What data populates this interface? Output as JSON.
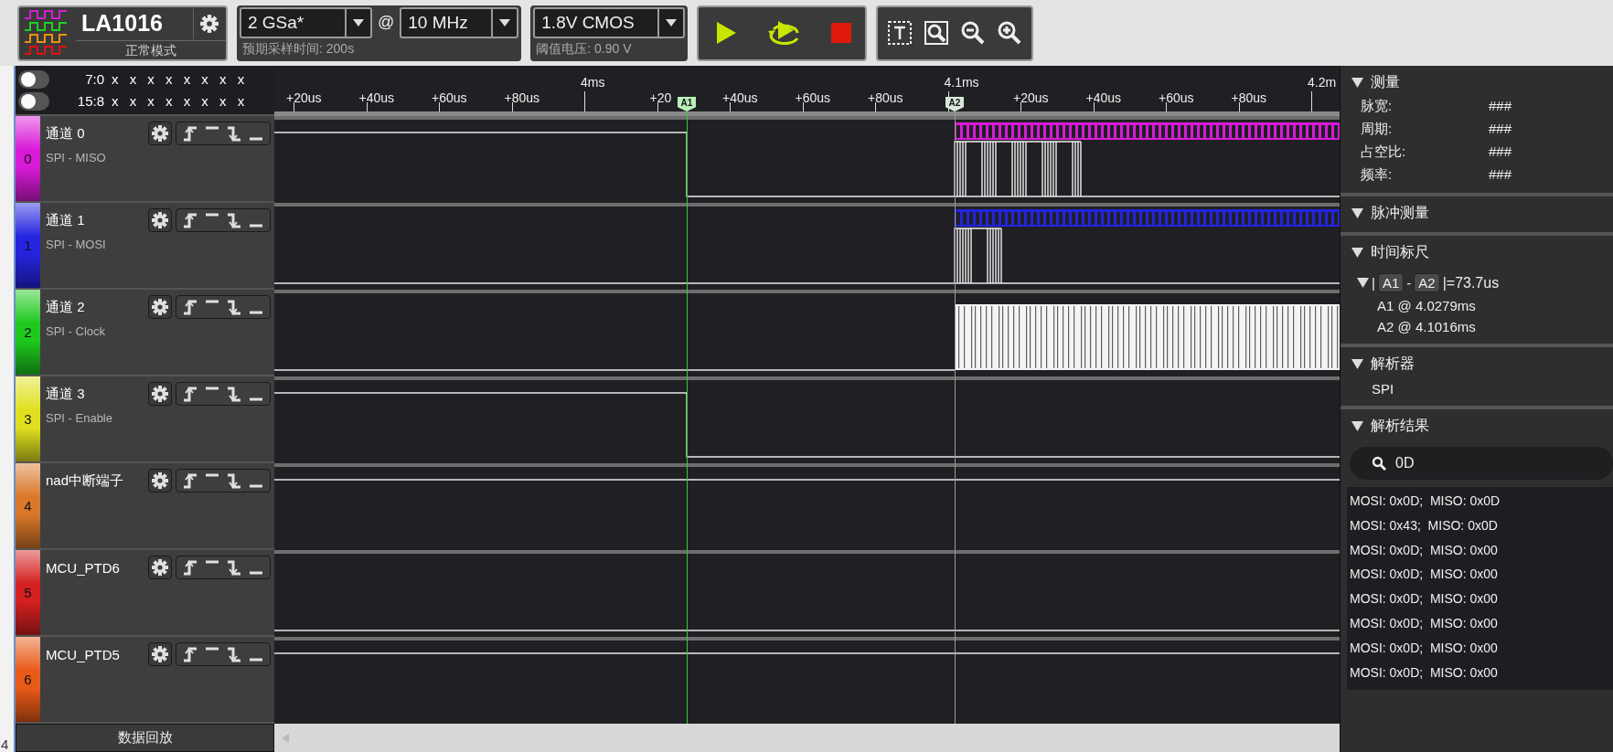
{
  "toolbar": {
    "device": {
      "name": "LA1016",
      "mode": "正常模式"
    },
    "sample_rate": "2 GSa*",
    "at": "@",
    "frequency": "10 MHz",
    "sample_time": "预期采样时间: 200s",
    "threshold": {
      "value": "1.8V CMOS",
      "caption": "阈值电压: 0.90 V"
    }
  },
  "bit_rows": [
    {
      "label": "7:0",
      "bits": "x x x x x x x x",
      "on": false
    },
    {
      "label": "15:8",
      "bits": "x x x x x x x x",
      "on": false
    }
  ],
  "timeline": {
    "ticks": [
      {
        "label": "+20us",
        "major": false
      },
      {
        "label": "+40us",
        "major": false
      },
      {
        "label": "+60us",
        "major": false
      },
      {
        "label": "+80us",
        "major": false
      },
      {
        "label": "4ms",
        "major": true
      },
      {
        "label": "+20",
        "major": false
      },
      {
        "label": "+40us",
        "major": false
      },
      {
        "label": "+60us",
        "major": false
      },
      {
        "label": "+80us",
        "major": false
      },
      {
        "label": "4.1ms",
        "major": true
      },
      {
        "label": "+20us",
        "major": false
      },
      {
        "label": "+40us",
        "major": false
      },
      {
        "label": "+60us",
        "major": false
      },
      {
        "label": "+80us",
        "major": false
      },
      {
        "label": "4.2m",
        "major": true
      }
    ],
    "cursors": [
      {
        "label": "A1",
        "kind": "active"
      },
      {
        "label": "A2",
        "kind": "passive"
      }
    ]
  },
  "channels": [
    {
      "number": "0",
      "name": "通道 0",
      "protocol": "SPI - MISO",
      "color": "#d81ad8",
      "kind": "fall_burst"
    },
    {
      "number": "1",
      "name": "通道 1",
      "protocol": "SPI - MOSI",
      "color": "#2424e0",
      "kind": "burst"
    },
    {
      "number": "2",
      "name": "通道 2",
      "protocol": "SPI - Clock",
      "color": "#1ec81e",
      "kind": "clock"
    },
    {
      "number": "3",
      "name": "通道 3",
      "protocol": "SPI - Enable",
      "color": "#e0e020",
      "kind": "fall"
    },
    {
      "number": "4",
      "name": "nad中断端子",
      "color": "#d9782a",
      "kind": "high"
    },
    {
      "number": "5",
      "name": "MCU_PTD6",
      "color": "#d42020",
      "kind": "low"
    },
    {
      "number": "6",
      "name": "MCU_PTD5",
      "color": "#e85a18",
      "kind": "high"
    }
  ],
  "replay_button": "数据回放",
  "edge_text": "4",
  "panel": {
    "measure": {
      "title": "测量",
      "expanded": true,
      "rows": [
        {
          "label": "脉宽:",
          "value": "###"
        },
        {
          "label": "周期:",
          "value": "###"
        },
        {
          "label": "占空比:",
          "value": "###"
        },
        {
          "label": "频率:",
          "value": "###"
        }
      ]
    },
    "pulse": {
      "title": "脉冲测量",
      "expanded": true
    },
    "ruler": {
      "title": "时间标尺",
      "expanded": true,
      "pair_expanded": true,
      "bar_left": "|",
      "first": "A1",
      "dash": "-",
      "second": "A2",
      "result": "|=73.7us",
      "lines": [
        "A1 @ 4.0279ms",
        "A2 @ 4.1016ms"
      ]
    },
    "decoder": {
      "title": "解析器",
      "expanded": true,
      "items": [
        "SPI"
      ]
    },
    "results": {
      "title": "解析结果",
      "expanded": true,
      "search": "0D",
      "rows": [
        "MOSI: 0x0D;  MISO: 0x0D",
        "MOSI: 0x43;  MISO: 0x0D",
        "MOSI: 0x0D;  MISO: 0x00",
        "MOSI: 0x0D;  MISO: 0x00",
        "MOSI: 0x0D;  MISO: 0x00",
        "MOSI: 0x0D;  MISO: 0x00",
        "MOSI: 0x0D;  MISO: 0x00",
        "MOSI: 0x0D;  MISO: 0x00"
      ]
    }
  }
}
